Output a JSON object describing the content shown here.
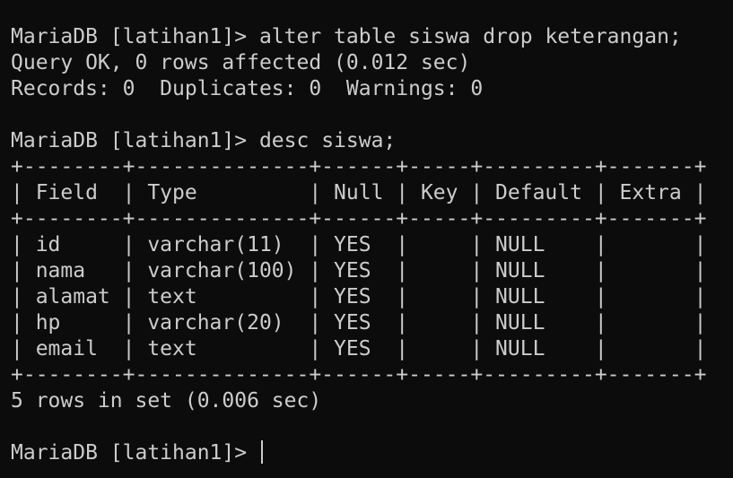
{
  "prompt": "MariaDB [latihan1]> ",
  "commands": {
    "alter": "alter table siswa drop keterangan;",
    "desc": "desc siswa;"
  },
  "alter_result": {
    "status": "Query OK, 0 rows affected (0.012 sec)",
    "records": "Records: 0  Duplicates: 0  Warnings: 0"
  },
  "table": {
    "border": "+--------+--------------+------+-----+---------+-------+",
    "header": "| Field  | Type         | Null | Key | Default | Extra |",
    "rows": [
      "| id     | varchar(11)  | YES  |     | NULL    |       |",
      "| nama   | varchar(100) | YES  |     | NULL    |       |",
      "| alamat | text         | YES  |     | NULL    |       |",
      "| hp     | varchar(20)  | YES  |     | NULL    |       |",
      "| email  | text         | YES  |     | NULL    |       |"
    ]
  },
  "desc_result": "5 rows in set (0.006 sec)",
  "colors": {
    "background": "#0c0c0c",
    "foreground": "#cccccc"
  }
}
